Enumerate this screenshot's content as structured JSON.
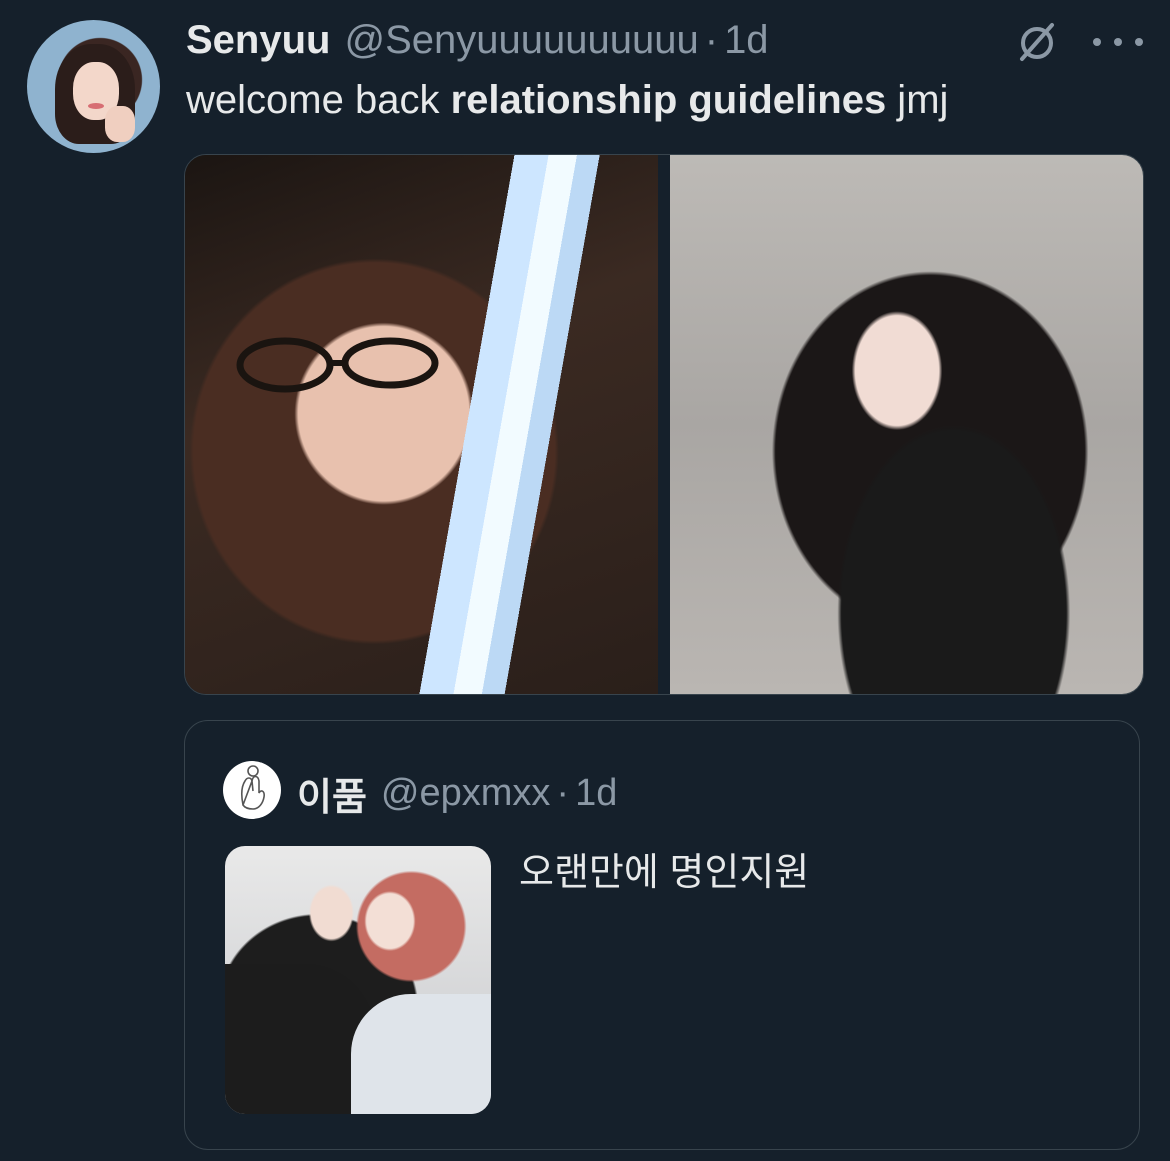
{
  "tweet": {
    "author_name": "Senyuu",
    "author_handle": "@Senyuuuuuuuuuu",
    "separator": "·",
    "time": "1d",
    "text_prefix": "welcome back ",
    "text_bold": "relationship guidelines",
    "text_suffix": " jmj",
    "icons": [
      "grok-icon",
      "more-options-icon"
    ]
  },
  "quoted": {
    "author_name": "이품",
    "author_handle": "@epxmxx",
    "separator": "·",
    "time": "1d",
    "text": "오랜만에 명인지원"
  },
  "colors": {
    "background": "#15202b",
    "text": "#e7e9ea",
    "secondary_text": "#8b98a5",
    "border": "#38444d"
  }
}
